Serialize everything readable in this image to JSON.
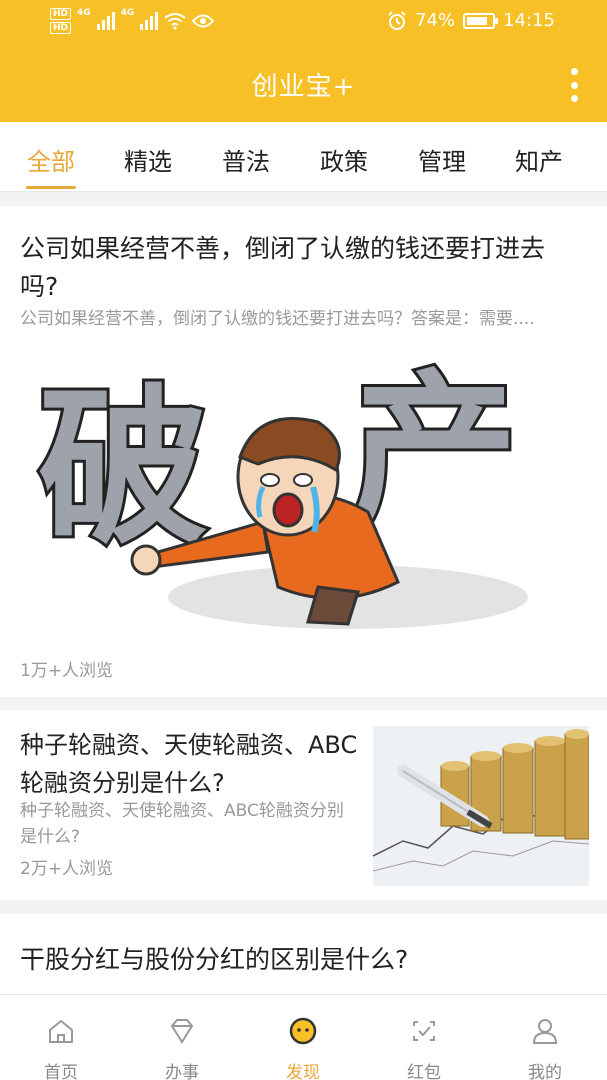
{
  "status": {
    "hd1": "HD",
    "hd2": "HD",
    "net1": "4G",
    "net2": "4G",
    "battery": "74%",
    "time": "14:15"
  },
  "header": {
    "title": "创业宝+"
  },
  "tabs": [
    {
      "label": "全部",
      "active": true
    },
    {
      "label": "精选"
    },
    {
      "label": "普法"
    },
    {
      "label": "政策"
    },
    {
      "label": "管理"
    },
    {
      "label": "知产"
    }
  ],
  "feed": [
    {
      "title": "公司如果经营不善，倒闭了认缴的钱还要打进去吗?",
      "summary": "公司如果经营不善，倒闭了认缴的钱还要打进去吗？答案是：需要....",
      "image_text": [
        "破",
        "产"
      ],
      "views": "1万+人浏览"
    },
    {
      "title": "种子轮融资、天使轮融资、ABC轮融资分别是什么?",
      "summary": "种子轮融资、天使轮融资、ABC轮融资分别是什么?",
      "views": "2万+人浏览"
    },
    {
      "title": "干股分红与股份分红的区别是什么?"
    }
  ],
  "bottom_nav": [
    {
      "label": "首页",
      "icon": "home-icon"
    },
    {
      "label": "办事",
      "icon": "diamond-icon"
    },
    {
      "label": "发现",
      "icon": "discover-icon",
      "active": true
    },
    {
      "label": "红包",
      "icon": "redpacket-icon"
    },
    {
      "label": "我的",
      "icon": "user-icon"
    }
  ],
  "colors": {
    "brand": "#f6c026",
    "accent": "#e9a93a",
    "muted": "#999999"
  }
}
